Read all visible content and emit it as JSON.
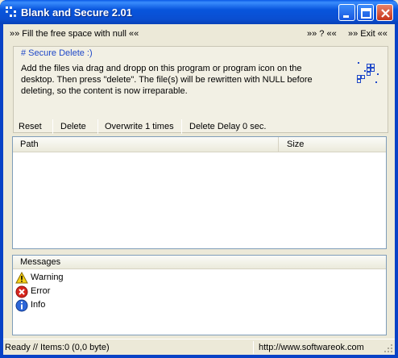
{
  "window": {
    "title": "Blank and Secure 2.01",
    "controls": {
      "minimize": "minimize-icon",
      "maximize": "maximize-icon",
      "close": "close-icon"
    }
  },
  "menu": {
    "fill_free_space": "»» Fill the free space with null ««",
    "help": "»» ? ««",
    "exit": "»» Exit ««"
  },
  "info": {
    "heading": "# Secure Delete :)",
    "text": "Add the files via drag and dropp on this program or program icon on the desktop. Then press \"delete\". The file(s) will be rewritten with NULL before deleting, so the content is now irreparable."
  },
  "toolbar": {
    "reset": "Reset",
    "delete": "Delete",
    "overwrite": "Overwrite 1 times",
    "delete_delay": "Delete Delay 0 sec."
  },
  "file_list": {
    "columns": [
      "Path",
      "Size"
    ],
    "rows": []
  },
  "messages": {
    "header": "Messages",
    "items": [
      {
        "icon": "warning-icon",
        "label": "Warning"
      },
      {
        "icon": "error-icon",
        "label": "Error"
      },
      {
        "icon": "info-icon",
        "label": "Info"
      }
    ]
  },
  "status": {
    "left": "Ready // Items:0 (0,0 byte)",
    "right": "http://www.softwareok.com"
  },
  "colors": {
    "titlebar": "#0a4ed0",
    "window_bg": "#ece9d8",
    "heading": "#1f48c8",
    "list_border": "#7f9db9"
  }
}
